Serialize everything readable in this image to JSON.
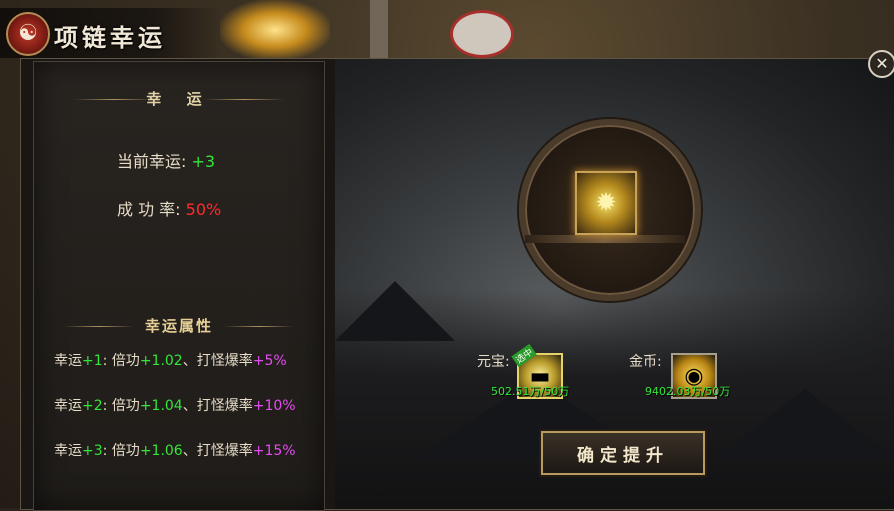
{
  "title": "项链幸运",
  "left_panel": {
    "luck_heading": "幸 运",
    "current_luck_label": "当前幸运:",
    "current_luck_value": "+3",
    "success_rate_label": "成 功 率:",
    "success_rate_value": "50%",
    "attr_heading": "幸运属性",
    "attributes": [
      {
        "luck": "幸运",
        "luck_level": "+1",
        "mid": ": 倍功",
        "mult": "+1.02",
        "sep": "、打怪爆率",
        "drop": "+5%"
      },
      {
        "luck": "幸运",
        "luck_level": "+2",
        "mid": ": 倍功",
        "mult": "+1.04",
        "sep": "、打怪爆率",
        "drop": "+10%"
      },
      {
        "luck": "幸运",
        "luck_level": "+3",
        "mid": ": 倍功",
        "mult": "+1.06",
        "sep": "、打怪爆率",
        "drop": "+15%"
      }
    ]
  },
  "right_panel": {
    "yuanbao_label": "元宝:",
    "yuanbao_value": "502.51万/50万",
    "yuanbao_badge": "选中",
    "gold_label": "金币:",
    "gold_value": "9402.03万/50万",
    "confirm_label": "确定提升"
  },
  "close_symbol": "✕",
  "colors": {
    "green": "#33e63a",
    "red": "#ff2a2a",
    "purple": "#e44cf0",
    "gold_border": "#c9a25a"
  },
  "icons": {
    "title_emblem": "yin-yang-icon",
    "item": "necklace-icon",
    "yuanbao": "gold-ingot-icon",
    "gold": "gold-coins-icon"
  }
}
